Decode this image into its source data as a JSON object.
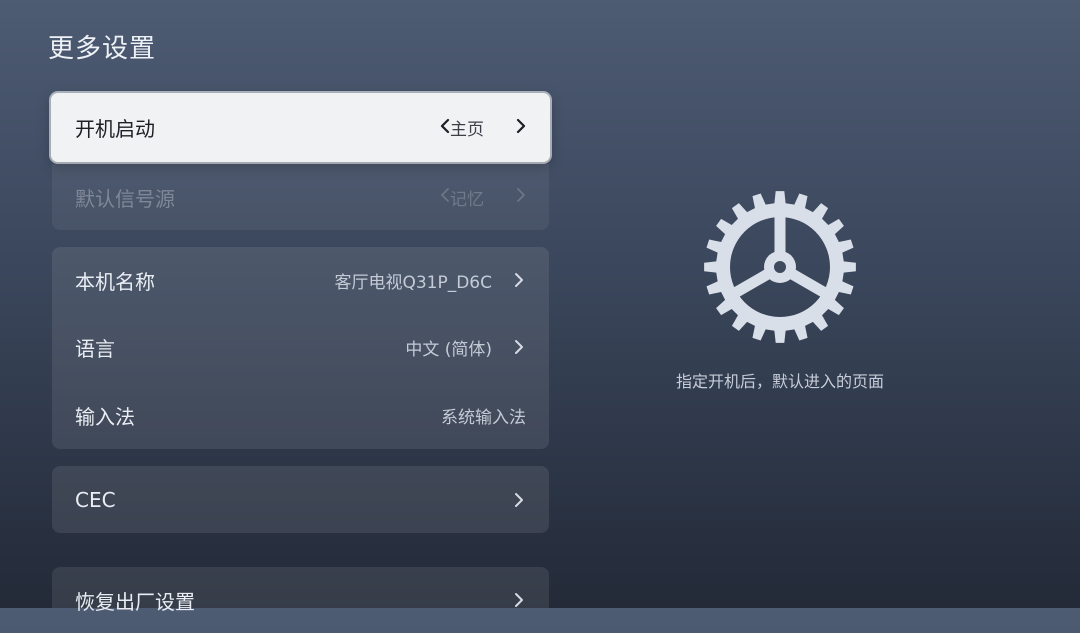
{
  "page": {
    "title": "更多设置"
  },
  "startup": {
    "label": "开机启动",
    "value": "主页"
  },
  "default_source": {
    "label": "默认信号源",
    "value": "记忆"
  },
  "device_name": {
    "label": "本机名称",
    "value": "客厅电视Q31P_D6C"
  },
  "language": {
    "label": "语言",
    "value": "中文 (简体)"
  },
  "input_method": {
    "label": "输入法",
    "value": "系统输入法"
  },
  "cec": {
    "label": "CEC"
  },
  "factory_reset": {
    "label": "恢复出厂设置"
  },
  "detail": {
    "icon": "gear-icon",
    "description": "指定开机后，默认进入的页面"
  },
  "colors": {
    "focus_bg": "#f1f2f4",
    "panel_bg": "#4d5b73",
    "text_primary": "#eaeef4"
  }
}
